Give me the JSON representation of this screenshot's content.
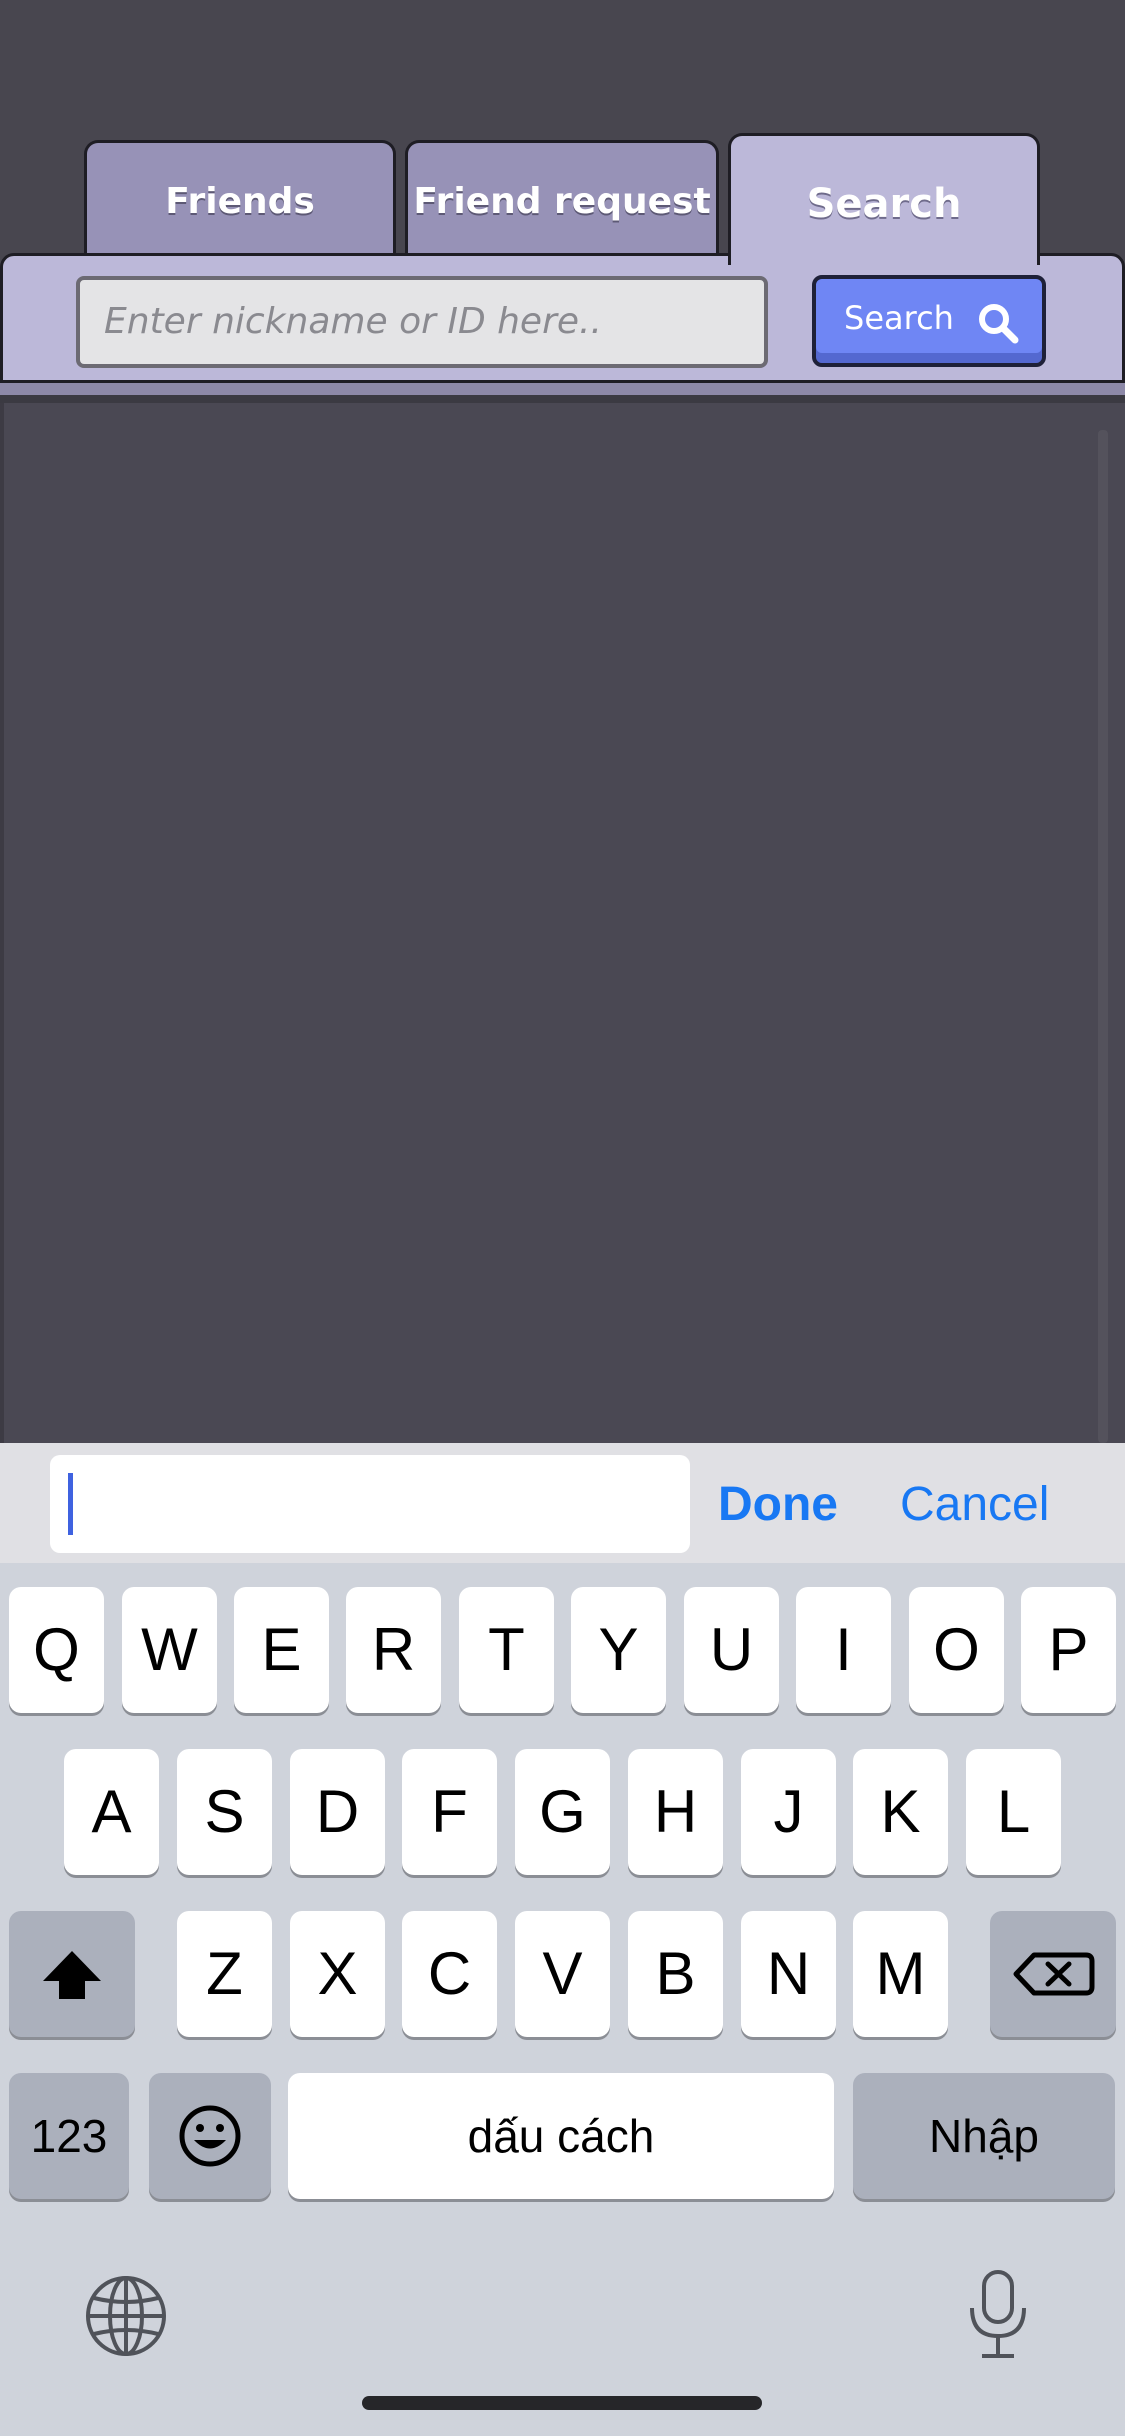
{
  "tabs": {
    "friends": "Friends",
    "friend_request": "Friend request",
    "search": "Search",
    "active": "search"
  },
  "search_panel": {
    "placeholder": "Enter nickname or ID here..",
    "button_label": "Search"
  },
  "input_accessory": {
    "value": "",
    "done_label": "Done",
    "cancel_label": "Cancel"
  },
  "keyboard": {
    "row1": [
      "Q",
      "W",
      "E",
      "R",
      "T",
      "Y",
      "U",
      "I",
      "O",
      "P"
    ],
    "row2": [
      "A",
      "S",
      "D",
      "F",
      "G",
      "H",
      "J",
      "K",
      "L"
    ],
    "row3": [
      "Z",
      "X",
      "C",
      "V",
      "B",
      "N",
      "M"
    ],
    "numbers_label": "123",
    "space_label": "dấu cách",
    "return_label": "Nhập",
    "icons": {
      "shift": "shift-icon",
      "delete": "backspace-icon",
      "emoji": "emoji-icon",
      "globe": "globe-icon",
      "dictation": "microphone-icon"
    }
  },
  "colors": {
    "background": "#48464f",
    "panel": "#bcb8d9",
    "inactive_tab": "#9792b7",
    "search_button": "#6f86f4",
    "accessory_action": "#1878f3"
  }
}
